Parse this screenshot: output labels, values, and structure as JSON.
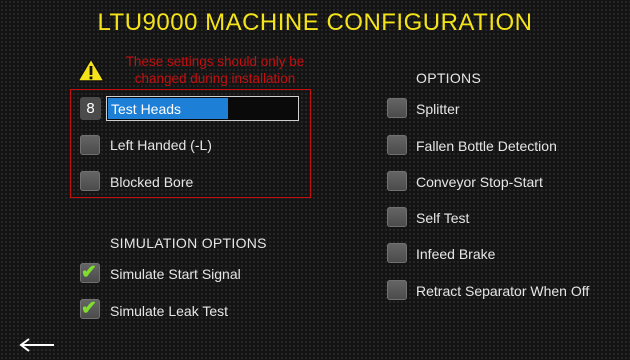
{
  "title": "LTU9000 MACHINE CONFIGURATION",
  "warning": {
    "icon": "warning-icon",
    "line1": "These settings should only be",
    "line2": "changed during installation"
  },
  "install_settings": {
    "test_heads": {
      "count": "8",
      "label": "Test Heads",
      "fill_fraction": 0.63
    },
    "left_handed": {
      "label": "Left Handed (-L)",
      "checked": false
    },
    "blocked_bore": {
      "label": "Blocked Bore",
      "checked": false
    }
  },
  "simulation": {
    "heading": "SIMULATION OPTIONS",
    "items": [
      {
        "label": "Simulate Start Signal",
        "checked": true
      },
      {
        "label": "Simulate Leak Test",
        "checked": true
      }
    ]
  },
  "options": {
    "heading": "OPTIONS",
    "items": [
      {
        "label": "Splitter",
        "checked": false
      },
      {
        "label": "Fallen Bottle Detection",
        "checked": false
      },
      {
        "label": "Conveyor Stop-Start",
        "checked": false
      },
      {
        "label": "Self Test",
        "checked": false
      },
      {
        "label": "Infeed Brake",
        "checked": false
      },
      {
        "label": "Retract Separator When Off",
        "checked": false
      }
    ]
  },
  "navigation": {
    "back_icon": "back-arrow-icon"
  },
  "colors": {
    "title": "#f5e31a",
    "warning": "#c40f0f",
    "bar": "#1d7fd6",
    "check": "#7fdd2e"
  }
}
